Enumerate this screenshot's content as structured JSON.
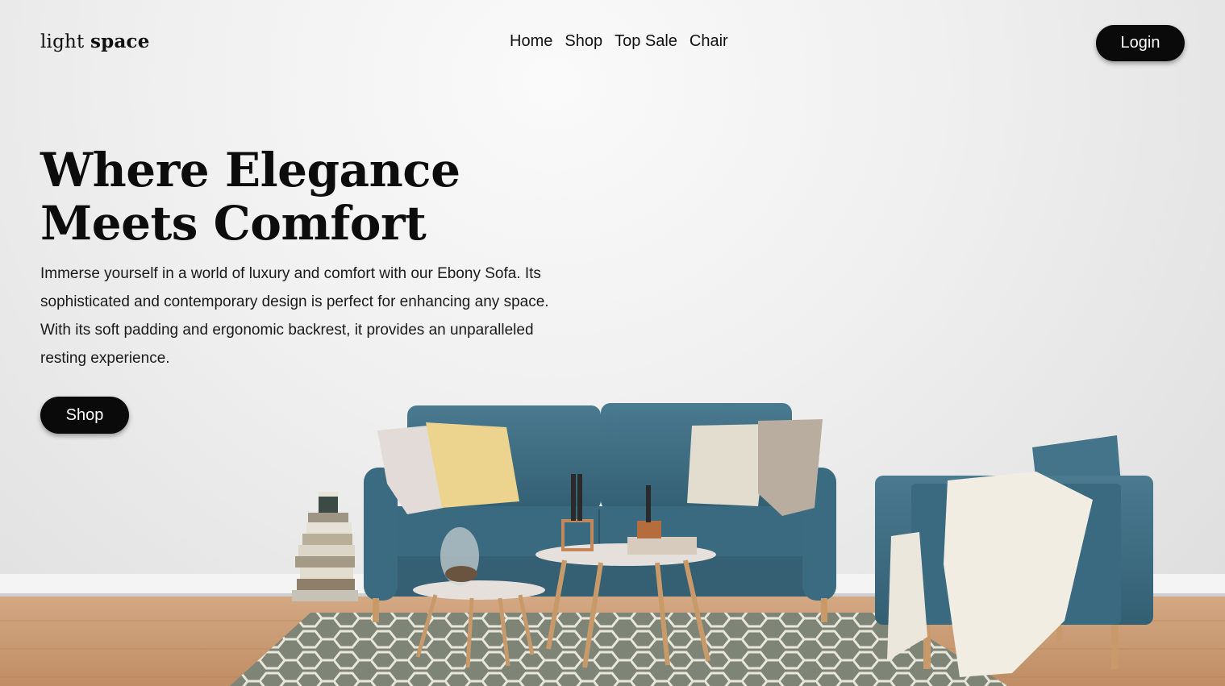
{
  "brand": {
    "logo_light": "light",
    "logo_bold": "space"
  },
  "nav": {
    "items": [
      "Home",
      "Shop",
      "Top Sale",
      "Chair"
    ],
    "login_label": "Login"
  },
  "hero": {
    "title": "Where Elegance Meets Comfort",
    "description": "Immerse yourself in a world of luxury and comfort with our Ebony Sofa. Its sophisticated and contemporary design is perfect for enhancing any space. With its soft padding and ergonomic backrest, it provides an unparalleled resting experience.",
    "cta_label": "Shop"
  },
  "colors": {
    "button_bg": "#0a0a0a",
    "button_text": "#ffffff",
    "sofa": "#3f6f85",
    "floor": "#c89a72",
    "rug": "#8a8f80"
  }
}
